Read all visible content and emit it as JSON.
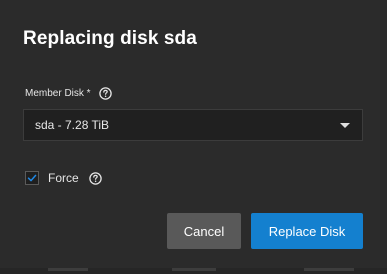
{
  "dialog": {
    "title": "Replacing disk sda",
    "member_disk": {
      "label": "Member Disk *",
      "help_icon": "help-circle-icon",
      "value": "sda - 7.28 TiB",
      "caret_icon": "caret-down-icon"
    },
    "force": {
      "label": "Force",
      "checked": true,
      "help_icon": "help-circle-icon"
    },
    "buttons": {
      "cancel": "Cancel",
      "replace": "Replace Disk"
    }
  },
  "colors": {
    "dialog_bg": "#2b2b2b",
    "primary": "#1480cf",
    "secondary": "#595959",
    "checkbox_check": "#1e88e5",
    "text": "#ffffff"
  }
}
